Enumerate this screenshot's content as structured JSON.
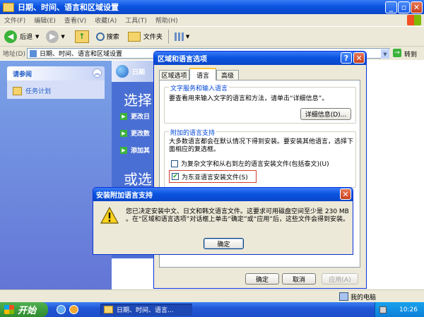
{
  "window": {
    "title": "日期、时间、语言和区域设置"
  },
  "menu": [
    "文件(F)",
    "编辑(E)",
    "查看(V)",
    "收藏(A)",
    "工具(T)",
    "帮助(H)"
  ],
  "toolbar": {
    "back": "后退",
    "search": "搜索",
    "folders": "文件夹"
  },
  "address": {
    "label": "地址(D)",
    "value": "日期、时间、语言和区域设置",
    "go": "转到"
  },
  "sidebar": {
    "title": "请参阅",
    "items": [
      "任务计划"
    ]
  },
  "content": {
    "banner_title": "日期",
    "heading1": "选择",
    "tasks": [
      "更改日",
      "更改数",
      "添加其"
    ],
    "heading2": "或选"
  },
  "regional": {
    "title": "区域和语言选项",
    "tabs": [
      "区域选项",
      "语言",
      "高级"
    ],
    "group1": {
      "title": "文字服务和输入语言",
      "text": "要查看用来输入文字的语言和方法，请单击“详细信息”。",
      "details_button": "详细信息(D)..."
    },
    "group2": {
      "title": "附加的语言支持",
      "text": "大多数语言都会在默认情况下得到安装。要安装其他语言，选择下面相应的复选框。",
      "check1": "为复杂文字和从右到左的语言安装文件(包括泰文)(U)",
      "check2": "为东亚语言安装文件(S)"
    },
    "buttons": {
      "ok": "确定",
      "cancel": "取消",
      "apply": "应用(A)"
    }
  },
  "alert": {
    "title": "安装附加语言支持",
    "message": "您已决定安装中文、日文和韩文语言文件。这要求可用磁盘空间至少是 230 MB 。在“区域和语言选项”对话框上单击“确定”或“应用”后，这些文件会得到安装。",
    "ok": "确定"
  },
  "status": {
    "computer": "我的电脑"
  },
  "taskbar": {
    "start": "开始",
    "task": "日期、时间、语言...",
    "clock": "10:26"
  }
}
